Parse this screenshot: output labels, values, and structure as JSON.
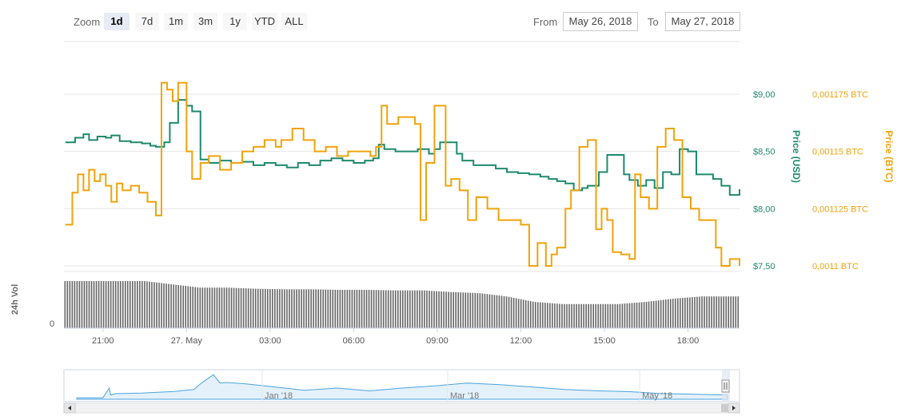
{
  "toolbar": {
    "zoom_label": "Zoom",
    "zoom_buttons": [
      "1d",
      "7d",
      "1m",
      "3m",
      "1y",
      "YTD",
      "ALL"
    ],
    "active_zoom": "1d",
    "from_label": "From",
    "to_label": "To",
    "from_value": "May 26, 2018",
    "to_value": "May 27, 2018"
  },
  "colors": {
    "usd": "#1e8a6e",
    "btc": "#f0a30a",
    "volume": "#666666",
    "navigator": "#4aa3df"
  },
  "chart_data": {
    "type": "line",
    "x_ticks": [
      "21:00",
      "27. May",
      "03:00",
      "06:00",
      "09:00",
      "12:00",
      "15:00",
      "18:00"
    ],
    "x_tick_hours": [
      21,
      24,
      27,
      30,
      33,
      36,
      39,
      42
    ],
    "x_range": [
      19.6,
      43.85
    ],
    "y_left": {
      "label": "Price (USD)",
      "ticks": [
        "$7,50",
        "$8,00",
        "$8,50",
        "$9,00"
      ],
      "tick_values": [
        7.5,
        8.0,
        8.5,
        9.0
      ],
      "range": [
        7.5,
        9.0
      ]
    },
    "y_right": {
      "label": "Price (BTC)",
      "ticks": [
        "0,0011 BTC",
        "0,001125 BTC",
        "0,00115 BTC",
        "0,001175 BTC"
      ],
      "tick_values": [
        0.0011,
        0.001125,
        0.00115,
        0.001175
      ],
      "range": [
        0.0011,
        0.001175
      ]
    },
    "volume_axis": {
      "label": "24h Vol",
      "tick": "0"
    },
    "navigator_ticks": [
      "Jan '18",
      "Mar '18",
      "May '18"
    ],
    "series": [
      {
        "name": "Price (USD)",
        "axis": "left",
        "x": [
          19.65,
          20,
          20.3,
          20.5,
          20.8,
          21.1,
          21.3,
          21.6,
          22,
          22.4,
          22.7,
          22.9,
          23.2,
          23.4,
          23.7,
          24,
          24.2,
          24.5,
          24.8,
          25.2,
          25.6,
          26,
          26.4,
          26.8,
          27.2,
          27.6,
          28,
          28.4,
          28.8,
          29.2,
          29.6,
          30,
          30.4,
          30.7,
          30.9,
          31.1,
          31.5,
          31.9,
          32.3,
          32.7,
          32.9,
          33.1,
          33.4,
          33.7,
          33.9,
          34.3,
          34.7,
          35.1,
          35.5,
          35.9,
          36.3,
          36.7,
          37,
          37.3,
          37.6,
          37.9,
          38.2,
          38.4,
          38.8,
          39.1,
          39.4,
          39.7,
          39.9,
          40.2,
          40.5,
          40.8,
          41.1,
          41.4,
          41.7,
          42,
          42.3,
          42.6,
          42.9,
          43.2,
          43.5,
          43.85
        ],
        "y": [
          8.58,
          8.62,
          8.65,
          8.6,
          8.63,
          8.62,
          8.64,
          8.59,
          8.58,
          8.57,
          8.55,
          8.54,
          8.58,
          8.75,
          8.95,
          8.9,
          8.85,
          8.43,
          8.4,
          8.42,
          8.4,
          8.41,
          8.38,
          8.4,
          8.38,
          8.36,
          8.4,
          8.38,
          8.42,
          8.44,
          8.42,
          8.4,
          8.42,
          8.44,
          8.56,
          8.52,
          8.5,
          8.5,
          8.52,
          8.48,
          8.52,
          8.58,
          8.58,
          8.48,
          8.42,
          8.38,
          8.38,
          8.35,
          8.32,
          8.31,
          8.3,
          8.28,
          8.26,
          8.24,
          8.22,
          8.16,
          8.18,
          8.2,
          8.32,
          8.47,
          8.47,
          8.3,
          8.25,
          8.2,
          8.25,
          8.18,
          8.32,
          8.3,
          8.52,
          8.5,
          8.3,
          8.3,
          8.26,
          8.2,
          8.12,
          8.17
        ]
      },
      {
        "name": "Price (BTC)",
        "axis": "right",
        "x": [
          19.65,
          19.9,
          20.1,
          20.3,
          20.5,
          20.7,
          20.9,
          21.1,
          21.3,
          21.5,
          21.7,
          22,
          22.3,
          22.6,
          22.9,
          23.1,
          23.3,
          23.5,
          23.7,
          24,
          24.2,
          24.5,
          24.8,
          25.2,
          25.6,
          26,
          26.4,
          26.8,
          27.2,
          27.4,
          27.8,
          28.2,
          28.6,
          29,
          29.4,
          29.8,
          30.2,
          30.6,
          30.8,
          31,
          31.2,
          31.6,
          31.9,
          32.2,
          32.4,
          32.6,
          32.9,
          33.1,
          33.3,
          33.5,
          33.8,
          34.1,
          34.4,
          34.8,
          35.2,
          35.6,
          36,
          36.3,
          36.6,
          36.9,
          37.1,
          37.3,
          37.6,
          37.8,
          38.1,
          38.4,
          38.7,
          38.9,
          39.1,
          39.3,
          39.6,
          39.9,
          40.1,
          40.3,
          40.6,
          40.9,
          41.2,
          41.5,
          41.8,
          42.1,
          42.4,
          42.7,
          43,
          43.2,
          43.5,
          43.85
        ],
        "y": [
          0.001118,
          0.001132,
          0.00114,
          0.001133,
          0.001142,
          0.001137,
          0.00114,
          0.001135,
          0.001128,
          0.001136,
          0.001133,
          0.001135,
          0.001132,
          0.001128,
          0.001122,
          0.00118,
          0.001177,
          0.001172,
          0.00118,
          0.00115,
          0.001138,
          0.001145,
          0.001148,
          0.001142,
          0.001145,
          0.00115,
          0.001152,
          0.001155,
          0.001152,
          0.001155,
          0.00116,
          0.001155,
          0.00115,
          0.001152,
          0.001148,
          0.00115,
          0.00115,
          0.001148,
          0.001152,
          0.00117,
          0.001162,
          0.001165,
          0.001165,
          0.001162,
          0.00112,
          0.001145,
          0.00117,
          0.00117,
          0.001135,
          0.001138,
          0.001133,
          0.00112,
          0.00113,
          0.001125,
          0.00112,
          0.00112,
          0.001118,
          0.0011,
          0.00111,
          0.0011,
          0.001105,
          0.001108,
          0.001125,
          0.001133,
          0.001152,
          0.001155,
          0.001116,
          0.001125,
          0.00112,
          0.001106,
          0.001105,
          0.001103,
          0.00114,
          0.00113,
          0.001125,
          0.001152,
          0.00116,
          0.001155,
          0.00113,
          0.001125,
          0.00112,
          0.00112,
          0.001108,
          0.0011,
          0.001103,
          0.0011
        ]
      },
      {
        "name": "24h Vol",
        "type": "column",
        "x": [
          19.65,
          20.5,
          21.5,
          22.5,
          23.5,
          24.5,
          25.5,
          26.5,
          27.5,
          28.5,
          29.5,
          30.5,
          31.5,
          32.5,
          33.5,
          34.5,
          35.5,
          36.5,
          37.5,
          38.5,
          39.5,
          40.5,
          41.5,
          42.5,
          43.85
        ],
        "y": [
          0.86,
          0.86,
          0.86,
          0.86,
          0.8,
          0.74,
          0.74,
          0.72,
          0.71,
          0.71,
          0.7,
          0.7,
          0.69,
          0.69,
          0.66,
          0.64,
          0.58,
          0.48,
          0.44,
          0.44,
          0.44,
          0.48,
          0.54,
          0.58,
          0.58
        ]
      },
      {
        "name": "Navigator",
        "x": [
          0,
          0.04,
          0.05,
          0.052,
          0.06,
          0.1,
          0.15,
          0.18,
          0.19,
          0.21,
          0.22,
          0.23,
          0.26,
          0.3,
          0.35,
          0.4,
          0.45,
          0.5,
          0.55,
          0.6,
          0.65,
          0.7,
          0.75,
          0.8,
          0.85,
          0.9,
          0.95,
          1
        ],
        "y": [
          0.05,
          0.05,
          0.4,
          0.15,
          0.2,
          0.22,
          0.28,
          0.35,
          0.55,
          0.88,
          0.58,
          0.6,
          0.55,
          0.45,
          0.32,
          0.4,
          0.3,
          0.4,
          0.48,
          0.58,
          0.52,
          0.44,
          0.35,
          0.3,
          0.27,
          0.2,
          0.18,
          0.15
        ]
      }
    ]
  }
}
